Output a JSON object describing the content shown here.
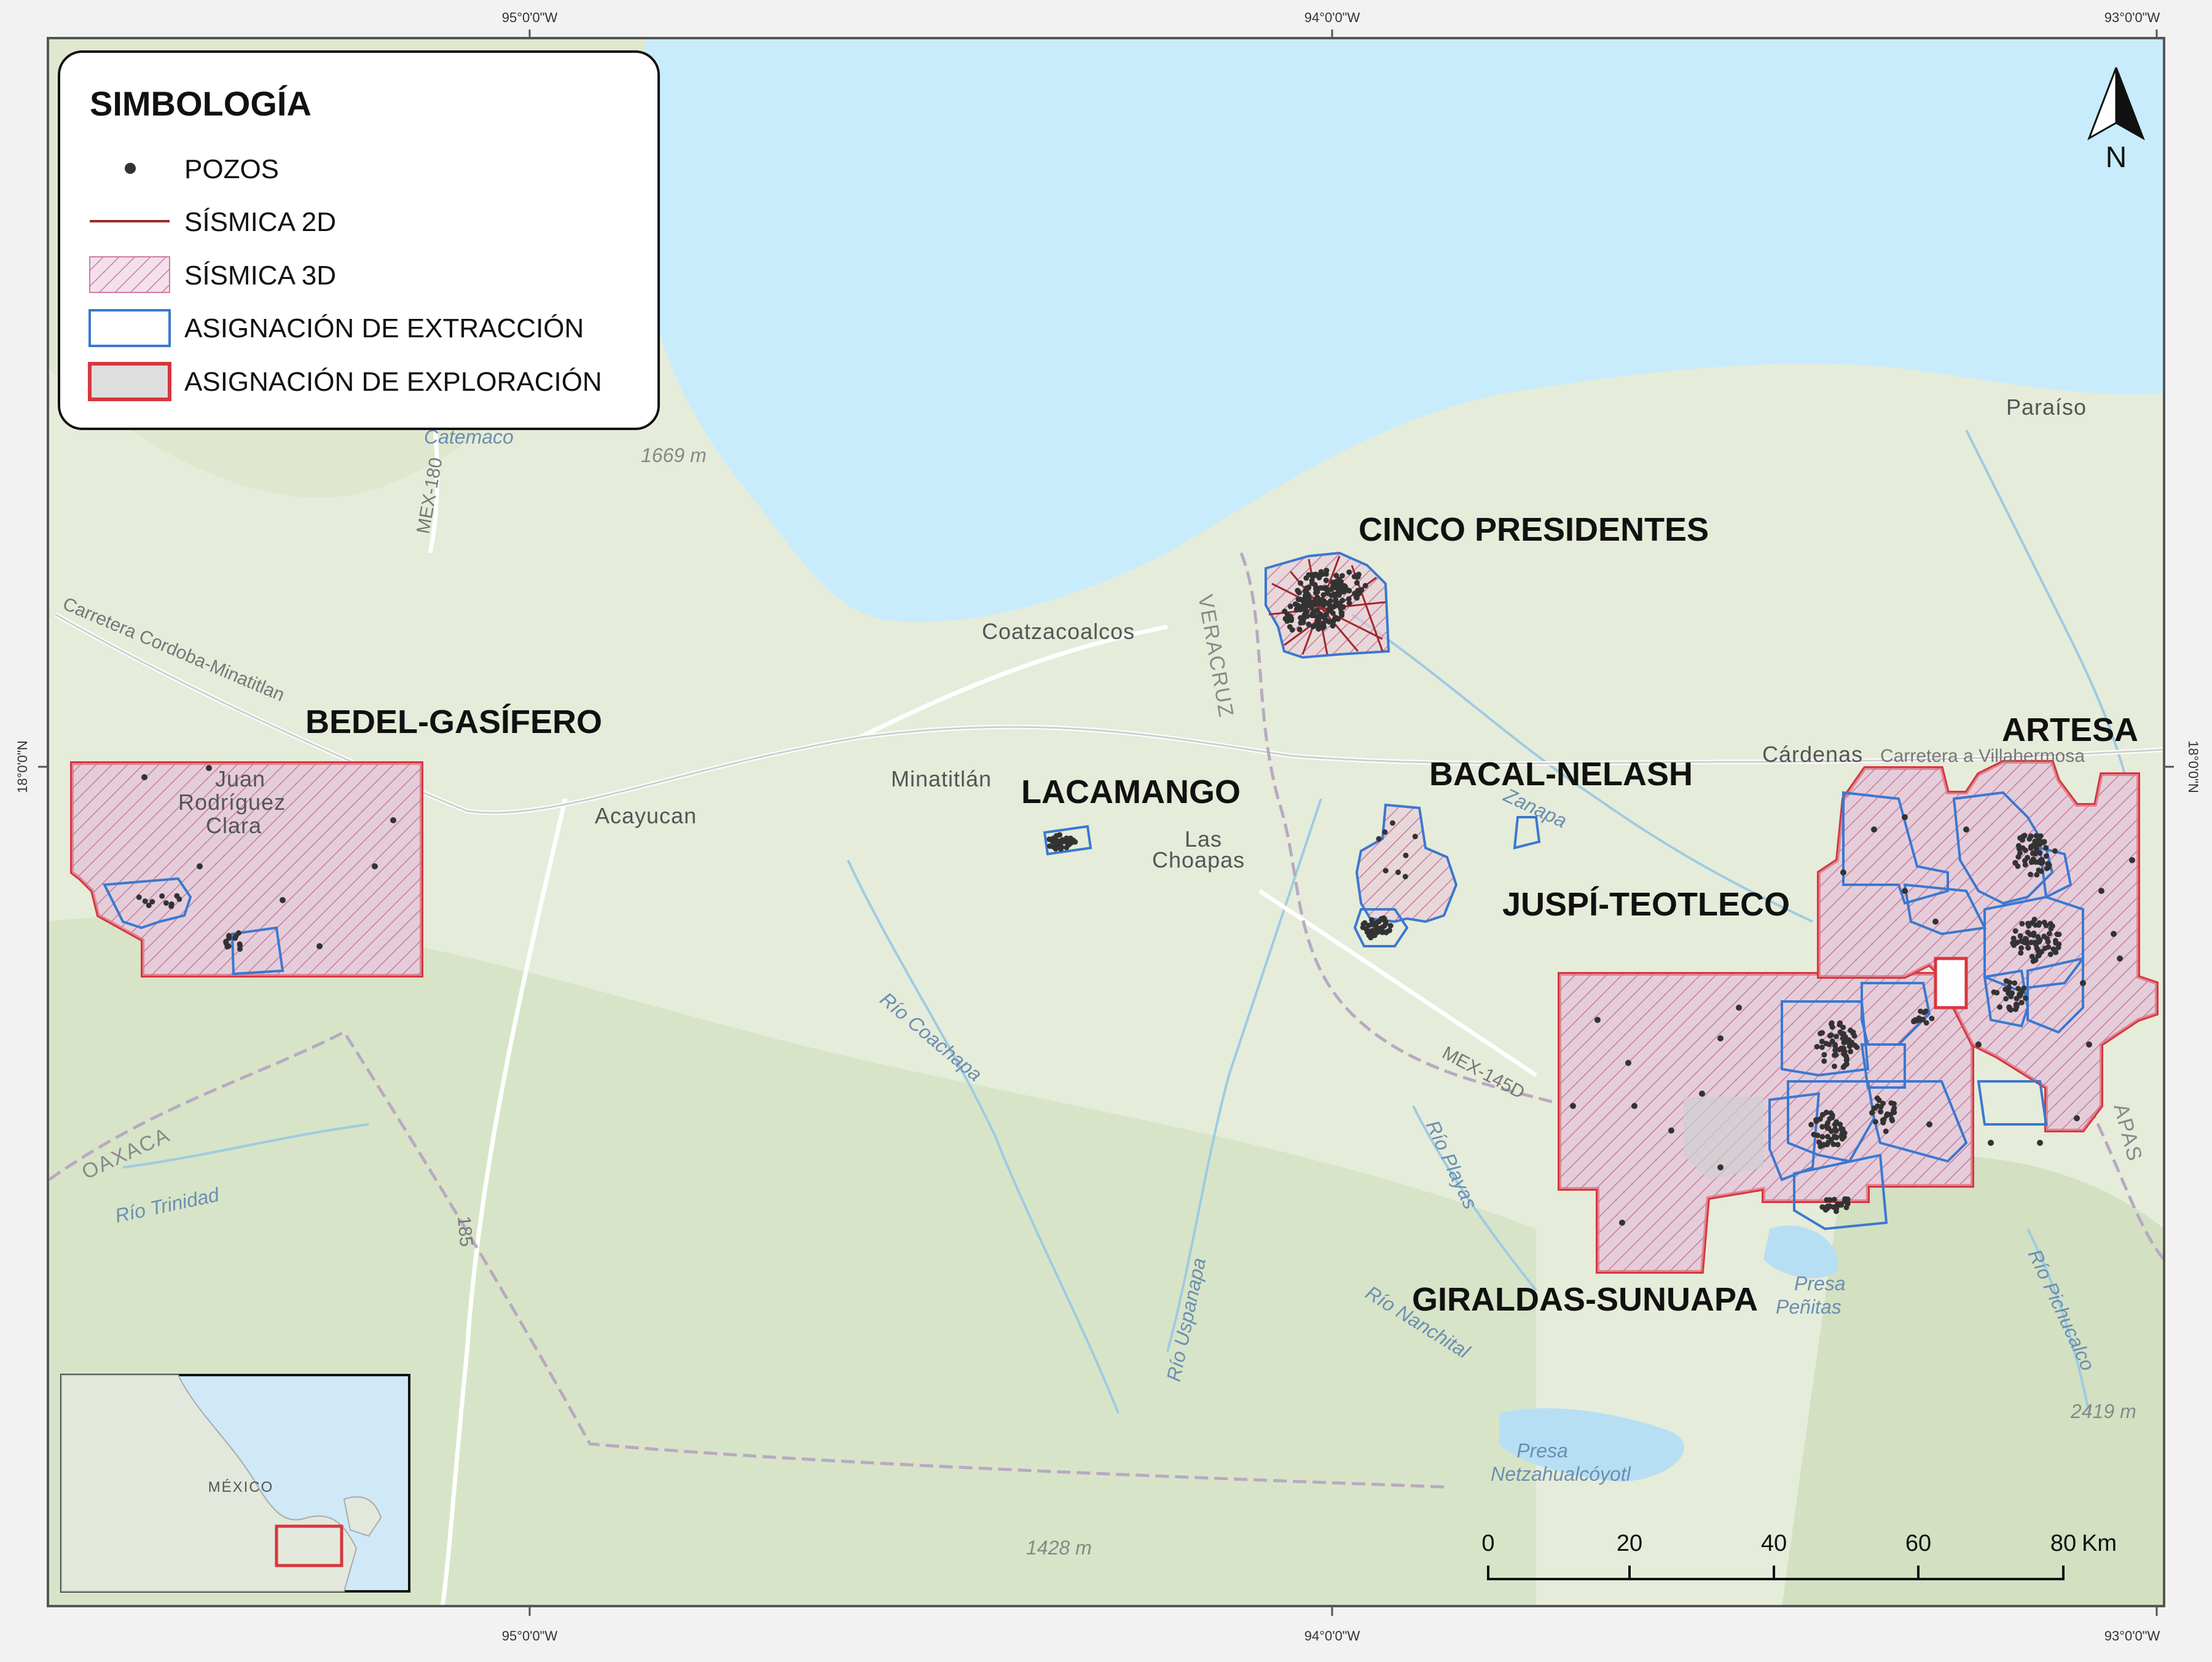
{
  "graticule": {
    "lon_labels": [
      "95°0'0\"W",
      "94°0'0\"W",
      "93°0'0\"W"
    ],
    "lat_labels": [
      "18°0'0\"N"
    ]
  },
  "legend": {
    "title": "SIMBOLOGÍA",
    "items": [
      {
        "symbol": "point",
        "label": "POZOS",
        "color": "#333333"
      },
      {
        "symbol": "line",
        "label": "SÍSMICA 2D",
        "color": "#a0282d"
      },
      {
        "symbol": "hatch",
        "label": "SÍSMICA 3D",
        "color": "#d27aa5"
      },
      {
        "symbol": "outline",
        "label": "ASIGNACIÓN DE EXTRACCIÓN",
        "color": "#3b78d0"
      },
      {
        "symbol": "fill",
        "label": "ASIGNACIÓN DE EXPLORACIÓN",
        "color": "#d7373f"
      }
    ]
  },
  "north_arrow": {
    "label": "N"
  },
  "fields": {
    "cinco_presidentes": "CINCO PRESIDENTES",
    "bedel_gasifero": "BEDEL-GASÍFERO",
    "lacamango": "LACAMANGO",
    "bacal_nelash": "BACAL-NELASH",
    "juspi_teotleco": "JUSPÍ-TEOTLECO",
    "artesa": "ARTESA",
    "giraldas_sunuapa": "GIRALDAS-SUNUAPA"
  },
  "places": {
    "paraiso": "Paraíso",
    "coatzacoalcos": "Coatzacoalcos",
    "minatitlan": "Minatitlán",
    "acayucan": "Acayucan",
    "las": "Las",
    "choapas": "Choapas",
    "cardenas": "Cárdenas",
    "carretera_villahermosa": "Carretera a Villahermosa",
    "juan": "Juan",
    "rodriguez": "Rodríguez",
    "clara": "Clara",
    "catemaco": "Catemaco",
    "presa_netzahualcoyotl_1": "Presa",
    "presa_netzahualcoyotl_2": "Netzahualcóyotl",
    "presa_penitas_1": "Presa",
    "presa_penitas_2": "Peñitas"
  },
  "states": {
    "veracruz": "VERACRUZ",
    "oaxaca": "OAXACA",
    "chiapas": "APAS"
  },
  "rivers": {
    "coachapa": "Río Coachapa",
    "trinidad": "Río Trinidad",
    "uspanapa": "Río Uspanapa",
    "nanchital": "Río Nanchital",
    "playas": "Río Playas",
    "zanapa": "Zanapa",
    "pichucalco": "Río Pichucalco"
  },
  "roads": {
    "carretera_cordoba": "Carretera Cordoba-Minatitlan",
    "mex_145d": "MEX-145D",
    "mex_180": "MEX-180",
    "r185": "185"
  },
  "elevations": {
    "e1669": "1669 m",
    "e1428": "1428 m",
    "e2419": "2419 m"
  },
  "scale_bar": {
    "ticks": [
      "0",
      "20",
      "40",
      "60",
      "80"
    ],
    "unit": "Km"
  },
  "inset": {
    "label": "MÉXICO"
  }
}
